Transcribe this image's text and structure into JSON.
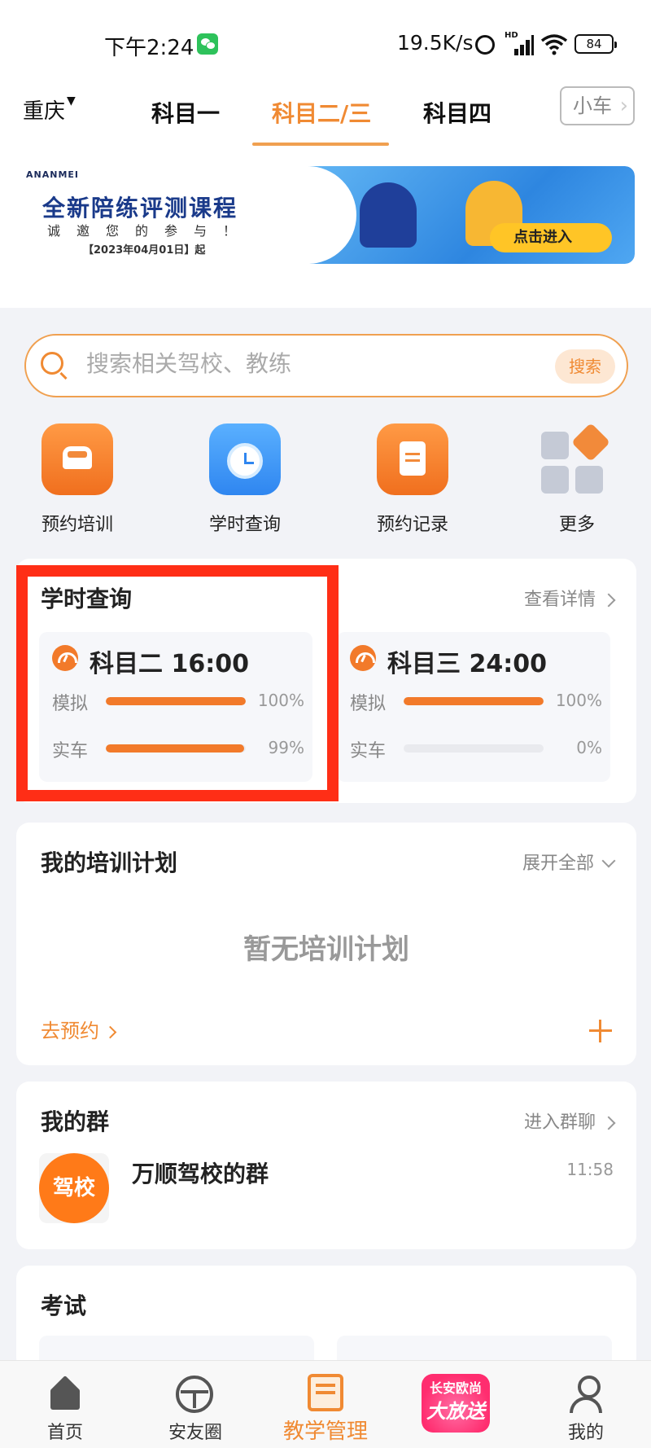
{
  "status_bar": {
    "time": "下午2:24",
    "net_speed": "19.5K/s",
    "battery": "84",
    "network_badge": "HD"
  },
  "header": {
    "city": "重庆",
    "tabs": [
      {
        "label": "科目一",
        "active": false
      },
      {
        "label": "科目二/三",
        "active": true
      },
      {
        "label": "科目四",
        "active": false
      }
    ],
    "car_button": "小车"
  },
  "banner": {
    "brand": "ANANMEI",
    "title": "全新陪练评测课程",
    "subtitle": "诚邀您的参与！",
    "date": "【2023年04月01日】起",
    "cta": "点击进入"
  },
  "search": {
    "placeholder": "搜索相关驾校、教练",
    "button": "搜索"
  },
  "quick_nav": [
    {
      "label": "预约培训",
      "icon": "car-icon"
    },
    {
      "label": "学时查询",
      "icon": "clock-icon"
    },
    {
      "label": "预约记录",
      "icon": "document-icon"
    },
    {
      "label": "更多",
      "icon": "more-grid-icon"
    }
  ],
  "study_hours": {
    "title": "学时查询",
    "link": "查看详情",
    "subjects": [
      {
        "name": "科目二",
        "hours": "16:00",
        "rows": [
          {
            "label": "模拟",
            "percent_text": "100%",
            "percent": 100
          },
          {
            "label": "实车",
            "percent_text": "99%",
            "percent": 99
          }
        ]
      },
      {
        "name": "科目三",
        "hours": "24:00",
        "rows": [
          {
            "label": "模拟",
            "percent_text": "100%",
            "percent": 100
          },
          {
            "label": "实车",
            "percent_text": "0%",
            "percent": 0
          }
        ]
      }
    ],
    "highlight_color": "#ff2e16"
  },
  "training_plan": {
    "title": "我的培训计划",
    "link": "展开全部",
    "empty_text": "暂无培训计划",
    "book_link": "去预约"
  },
  "groups": {
    "title": "我的群",
    "link": "进入群聊",
    "items": [
      {
        "avatar_text": "驾校",
        "name": "万顺驾校的群",
        "time": "11:58"
      }
    ]
  },
  "exam": {
    "title": "考试"
  },
  "tabbar": [
    {
      "label": "首页",
      "icon": "home-icon",
      "active": false
    },
    {
      "label": "安友圈",
      "icon": "steering-wheel-icon",
      "active": false
    },
    {
      "label": "教学管理",
      "icon": "book-icon",
      "active": true
    },
    {
      "label": "",
      "icon": "promo-icon",
      "active": false
    },
    {
      "label": "我的",
      "icon": "user-icon",
      "active": false
    }
  ],
  "promo": {
    "line1": "长安欧尚",
    "line2": "大放送"
  },
  "colors": {
    "accent": "#f08a33",
    "bar_fill": "#f27a2a",
    "highlight": "#ff2e16"
  }
}
